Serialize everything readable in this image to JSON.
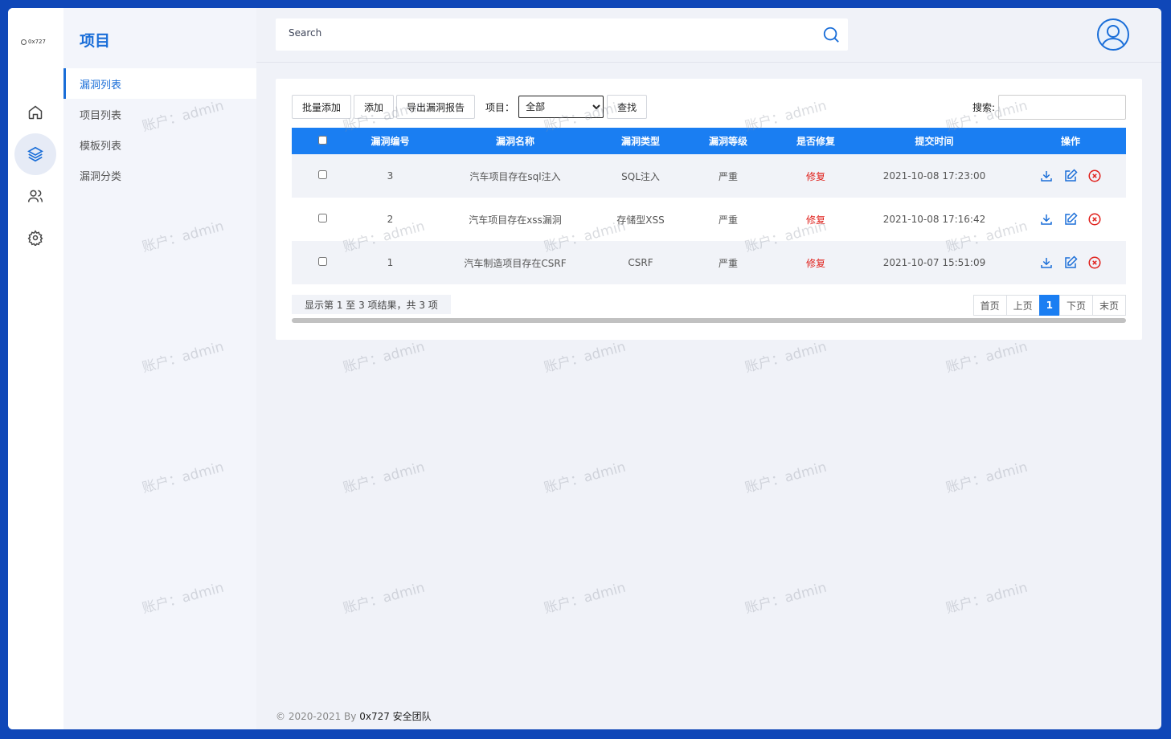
{
  "logo": {
    "text": "0x727"
  },
  "sidebar": {
    "title": "项目",
    "items": [
      {
        "label": "漏洞列表",
        "active": true
      },
      {
        "label": "项目列表"
      },
      {
        "label": "模板列表"
      },
      {
        "label": "漏洞分类"
      }
    ]
  },
  "rail": {
    "icons": [
      "home-icon",
      "layers-icon",
      "users-icon",
      "settings-icon"
    ],
    "active": "layers-icon"
  },
  "header": {
    "search_placeholder": "Search",
    "avatar_icon": "user-avatar-icon"
  },
  "toolbar": {
    "batch_add": "批量添加",
    "add": "添加",
    "export": "导出漏洞报告",
    "project_label": "项目：",
    "project_selected": "全部",
    "find": "查找",
    "search_label": "搜索:"
  },
  "table": {
    "headers": [
      "漏洞编号",
      "漏洞名称",
      "漏洞类型",
      "漏洞等级",
      "是否修复",
      "提交时间",
      "操作"
    ],
    "rows": [
      {
        "id": "3",
        "name": "汽车项目存在sql注入",
        "type": "SQL注入",
        "level": "严重",
        "fixed": "修复",
        "time": "2021-10-08 17:23:00"
      },
      {
        "id": "2",
        "name": "汽车项目存在xss漏洞",
        "type": "存储型XSS",
        "level": "严重",
        "fixed": "修复",
        "time": "2021-10-08 17:16:42"
      },
      {
        "id": "1",
        "name": "汽车制造项目存在CSRF",
        "type": "CSRF",
        "level": "严重",
        "fixed": "修复",
        "time": "2021-10-07 15:51:09"
      }
    ],
    "row_actions": [
      "download-icon",
      "edit-icon",
      "delete-icon"
    ]
  },
  "pagination": {
    "info": "显示第 1 至 3 项结果，共 3 项",
    "first": "首页",
    "prev": "上页",
    "current": "1",
    "next": "下页",
    "last": "末页"
  },
  "footer": {
    "copyright": "© 2020-2021 By",
    "team": "0x727 安全团队"
  },
  "watermark": {
    "text": "账户：admin"
  },
  "colors": {
    "brand": "#1a7ef2",
    "frame": "#0f47b8",
    "fixed": "#e0201b"
  }
}
